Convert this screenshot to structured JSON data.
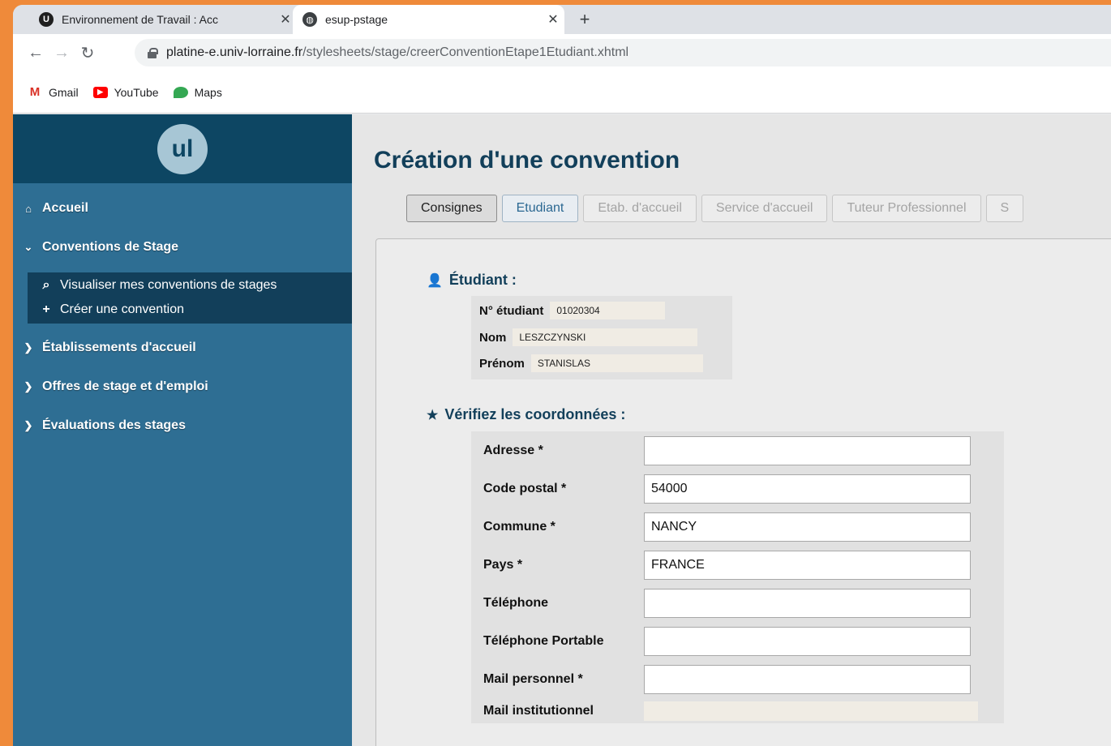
{
  "browser": {
    "tabs": [
      {
        "title": "Environnement de Travail : Acc",
        "favicon": "ul-icon",
        "active": false
      },
      {
        "title": "esup-pstage",
        "favicon": "globe-icon",
        "active": true
      }
    ],
    "url_host": "platine-e.univ-lorraine.fr",
    "url_path": "/stylesheets/stage/creerConventionEtape1Etudiant.xhtml",
    "bookmarks": [
      "Gmail",
      "YouTube",
      "Maps"
    ]
  },
  "sidebar": {
    "logo_text": "ul",
    "items": [
      {
        "label": "Accueil",
        "icon": "home-icon"
      },
      {
        "label": "Conventions de Stage",
        "icon": "chevron-down-icon"
      },
      {
        "label": "Établissements d'accueil",
        "icon": "chevron-right-icon"
      },
      {
        "label": "Offres de stage et d'emploi",
        "icon": "chevron-right-icon"
      },
      {
        "label": "Évaluations des stages",
        "icon": "chevron-right-icon"
      }
    ],
    "subitems": [
      {
        "label": "Visualiser mes conventions de stages",
        "icon": "search-icon"
      },
      {
        "label": "Créer une convention",
        "icon": "plus-icon"
      }
    ]
  },
  "main": {
    "title": "Création d'une convention",
    "tabs": [
      "Consignes",
      "Etudiant",
      "Etab. d'accueil",
      "Service d'accueil",
      "Tuteur Professionnel",
      "S"
    ],
    "student": {
      "heading": "Étudiant :",
      "fields": [
        {
          "label": "N° étudiant",
          "value": "01020304"
        },
        {
          "label": "Nom",
          "value": "LESZCZYNSKI"
        },
        {
          "label": "Prénom",
          "value": "STANISLAS"
        }
      ]
    },
    "coords": {
      "heading": "Vérifiez les coordonnées :",
      "fields": [
        {
          "label": "Adresse *",
          "value": ""
        },
        {
          "label": "Code postal *",
          "value": "54000"
        },
        {
          "label": "Commune *",
          "value": "NANCY"
        },
        {
          "label": "Pays *",
          "value": "FRANCE"
        },
        {
          "label": "Téléphone",
          "value": ""
        },
        {
          "label": "Téléphone Portable",
          "value": ""
        },
        {
          "label": "Mail personnel *",
          "value": ""
        },
        {
          "label": "Mail institutionnel",
          "value": ""
        }
      ]
    }
  },
  "colors": {
    "accent": "#123f5a",
    "sidebar": "#2e6e93",
    "sidebar_header": "#0d4663",
    "background_frame": "#ef8a3a"
  }
}
